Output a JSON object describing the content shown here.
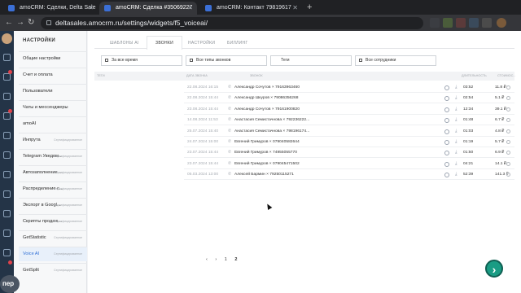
{
  "browser": {
    "tabs": [
      {
        "title": "amoCRM: Сделки, Delta Sale"
      },
      {
        "title": "amoCRM: Сделка #35069227"
      },
      {
        "title": "amoCRM: Контакт 79819617"
      }
    ],
    "new_tab": "+",
    "url": "deltasales.amocrm.ru/settings/widgets/f5_voiceai/"
  },
  "sidebar": {
    "title": "НАСТРОЙКИ",
    "items": [
      {
        "label": "Общие настройки",
        "meta": ""
      },
      {
        "label": "Счет и оплата",
        "meta": ""
      },
      {
        "label": "Пользователи",
        "meta": ""
      },
      {
        "label": "Чаты и мессенджеры",
        "meta": ""
      },
      {
        "label": "amoAI",
        "meta": ""
      },
      {
        "label": "Инпрута",
        "meta": "Сертифицированное"
      },
      {
        "label": "Telegram Уведом...",
        "meta": "Сертифицированное"
      },
      {
        "label": "Автозаполнение ...",
        "meta": "Сертифицированное"
      },
      {
        "label": "Распределение с...",
        "meta": "Сертифицированное"
      },
      {
        "label": "Экспорт в Googl...",
        "meta": "Сертифицированное"
      },
      {
        "label": "Скрипты продаж...",
        "meta": "Сертифицированное"
      },
      {
        "label": "GetStatistic",
        "meta": "Сертифицированное"
      },
      {
        "label": "Voice AI",
        "meta": "Сертифицированное"
      },
      {
        "label": "GetSplit",
        "meta": "Сертифицированное"
      }
    ]
  },
  "main": {
    "tabs": [
      "ШАБЛОНЫ AI",
      "ЗВОНКИ",
      "НАСТРОЙКИ",
      "БИЛЛИНГ"
    ],
    "filters": {
      "period": "За все время",
      "call_types": "Все типы звонков",
      "tags": "Теги",
      "staff": "Все сотрудники"
    },
    "columns": {
      "tags": "ТЕГИ",
      "date": "ДАТА ЗВОНКА",
      "call": "ЗВОНОК",
      "duration": "ДЛИТЕЛЬНОСТЬ",
      "cost": "СТОИМОС..."
    },
    "rows": [
      {
        "date": "22.08.2024 16:15",
        "call": "Александр Сочутов × 79163963460",
        "duration": "03:52",
        "cost": "11.8 ₽"
      },
      {
        "date": "22.08.2024 15:44",
        "call": "Александр Шкуров × 79086356268",
        "duration": "02:54",
        "cost": "5.1 ₽"
      },
      {
        "date": "23.08.2024 15:44",
        "call": "Александр Сочутов × 79161900820",
        "duration": "12:34",
        "cost": "39.1 ₽"
      },
      {
        "date": "14.08.2024 11:53",
        "call": "Анастасия Семистачнова × 792236222...",
        "duration": "01:48",
        "cost": "6.7 ₽"
      },
      {
        "date": "25.07.2024 15:40",
        "call": "Анастасия Семистачнова × 798196174...",
        "duration": "01:03",
        "cost": "4.8 ₽"
      },
      {
        "date": "24.07.2024 15:00",
        "call": "Евгений Гримуров × 079040582644",
        "duration": "01:19",
        "cost": "5.7 ₽"
      },
      {
        "date": "23.07.2024 15:44",
        "call": "Евгений Гримуров × 74955055770",
        "duration": "01:50",
        "cost": "6.9 ₽"
      },
      {
        "date": "23.07.2024 15:44",
        "call": "Евгений Гримуров × 079045471502",
        "duration": "04:21",
        "cost": "14.1 ₽"
      },
      {
        "date": "05.03.2024 13:00",
        "call": "Алексей Бармин × 79250115271",
        "duration": "52:39",
        "cost": "141.3 ₽"
      }
    ],
    "pager": {
      "prev": "‹",
      "next": "›",
      "pages": [
        "1",
        "2"
      ]
    }
  },
  "overlay": {
    "rec_label": "пер"
  },
  "colors": {
    "accent": "#2f6fd6",
    "fab": "#1a9c84",
    "rail": "#243447"
  }
}
